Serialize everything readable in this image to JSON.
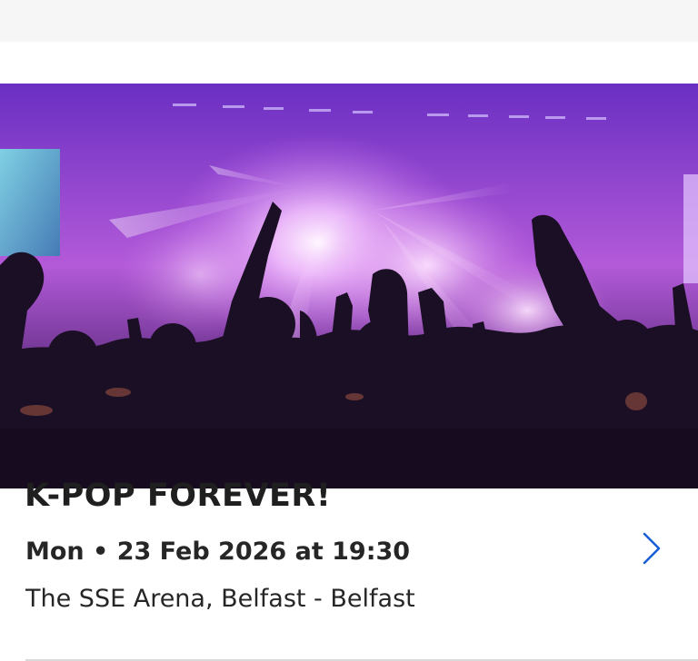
{
  "event": {
    "title": "K-POP FOREVER!",
    "date_line": "Mon • 23 Feb 2026 at 19:30",
    "venue_line": "The SSE Arena, Belfast - Belfast"
  },
  "icons": {
    "chevron": "chevron-right-icon"
  },
  "colors": {
    "accent": "#1a5fd6",
    "title": "#1f1f1f",
    "hero_glow": "#f3c6ff",
    "hero_purple": "#8a3fd1",
    "crowd": "#1b0f25"
  }
}
